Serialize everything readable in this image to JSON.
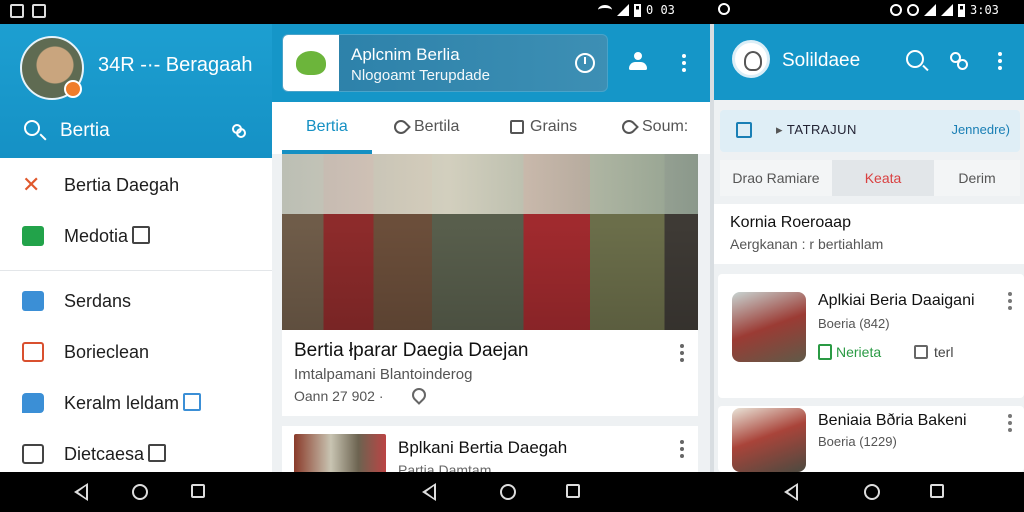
{
  "status_bar": {
    "time_left": "0 03",
    "time_right": "3:03"
  },
  "panel1": {
    "user_name": "34R -·- Beragaah",
    "search_label": "Bertia",
    "menu": [
      {
        "label": "Bertia Daegah",
        "icon": "cross-icon"
      },
      {
        "label": "Medotia",
        "icon": "tag-icon"
      },
      {
        "label": "Serdans",
        "icon": "clipboard-icon"
      },
      {
        "label": "Borieclean",
        "icon": "calendar-icon"
      },
      {
        "label": "Keralm leldam",
        "icon": "chat-icon"
      },
      {
        "label": "Dietcaesa",
        "icon": "window-icon"
      }
    ]
  },
  "panel2": {
    "header_title": "Aplcnim Berlia",
    "header_subtitle": "Nlogoamt Terupdade",
    "tabs": [
      {
        "label": "Bertia",
        "active": true
      },
      {
        "label": "Bertila",
        "active": false
      },
      {
        "label": "Grains",
        "active": false
      },
      {
        "label": "Soum:",
        "active": false
      }
    ],
    "featured": {
      "title": "Bertia łparar Daegia Daejan",
      "desc": "Imtalpamani Blantoinderog",
      "date": "Oann 27 902 ·"
    },
    "item2": {
      "title": "Bplkani Bertia Daegah",
      "sub": "Partia Damtam"
    }
  },
  "panel3": {
    "app_name": "Solildaee",
    "trans_label": "TATRAJUN",
    "trans_action": "Jennedre)",
    "segments": [
      "Drao Ramiare",
      "Keata",
      "Derim"
    ],
    "section": {
      "title": "Kornia Roeroaap",
      "sub": "Aergkanan : r bertiahlam"
    },
    "cards": [
      {
        "title": "Aplkiai Beria Daaigani",
        "sub": "Boeria (842)",
        "badge": "Nerieta",
        "check": "terl"
      },
      {
        "title": "Beniaia Bðria Bakeni",
        "sub": "Boeria (1229)"
      }
    ]
  },
  "colors": {
    "primary": "#1596c8",
    "accent_red": "#d94040",
    "accent_green": "#2a9a44"
  }
}
